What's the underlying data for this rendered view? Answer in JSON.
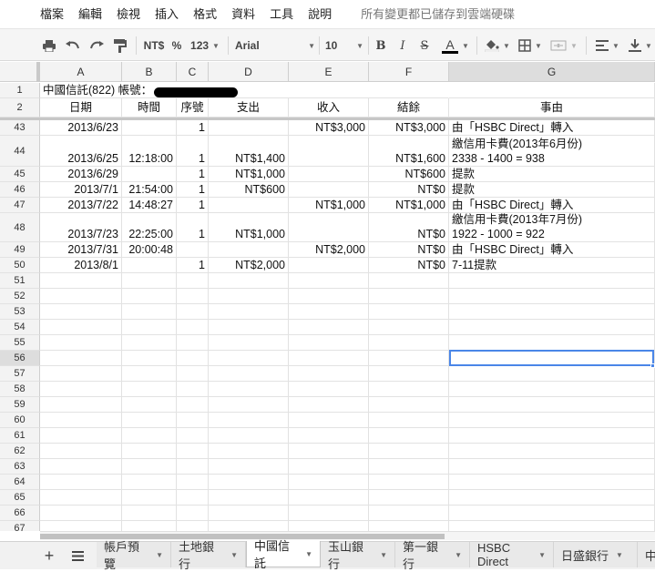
{
  "menu": {
    "items": [
      "檔案",
      "編輯",
      "檢視",
      "插入",
      "格式",
      "資料",
      "工具",
      "說明"
    ],
    "status": "所有變更都已儲存到雲端硬碟"
  },
  "toolbar": {
    "currency": "NT$",
    "percent": "%",
    "number_format": "123",
    "font": "Arial",
    "font_size": "10",
    "bold": "B",
    "italic": "I",
    "strike": "S",
    "text_color_letter": "A"
  },
  "columns": [
    "A",
    "B",
    "C",
    "D",
    "E",
    "F",
    "G"
  ],
  "selected_column": "G",
  "header_rows": {
    "r1_label": "1",
    "r1_title": "中國信託(822) 帳號：",
    "r2_label": "2",
    "r2_cells": [
      "日期",
      "時間",
      "序號",
      "支出",
      "收入",
      "結餘",
      "事由"
    ]
  },
  "rows": [
    {
      "n": "43",
      "cells": [
        "2013/6/23",
        "",
        "1",
        "",
        "NT$3,000",
        "NT$3,000",
        "由「HSBC Direct」轉入"
      ]
    },
    {
      "n": "44",
      "cells": [
        "2013/6/25",
        "12:18:00",
        "1",
        "NT$1,400",
        "",
        "NT$1,600",
        [
          "繳信用卡費(2013年6月份)",
          "2338 - 1400 = 938"
        ]
      ]
    },
    {
      "n": "45",
      "cells": [
        "2013/6/29",
        "",
        "1",
        "NT$1,000",
        "",
        "NT$600",
        "提款"
      ]
    },
    {
      "n": "46",
      "cells": [
        "2013/7/1",
        "21:54:00",
        "1",
        "NT$600",
        "",
        "NT$0",
        "提款"
      ]
    },
    {
      "n": "47",
      "cells": [
        "2013/7/22",
        "14:48:27",
        "1",
        "",
        "NT$1,000",
        "NT$1,000",
        "由「HSBC Direct」轉入"
      ]
    },
    {
      "n": "48",
      "cells": [
        "2013/7/23",
        "22:25:00",
        "1",
        "NT$1,000",
        "",
        "NT$0",
        [
          "繳信用卡費(2013年7月份)",
          "1922 - 1000 = 922"
        ]
      ]
    },
    {
      "n": "49",
      "cells": [
        "2013/7/31",
        "20:00:48",
        "",
        "",
        "NT$2,000",
        "NT$0",
        "由「HSBC Direct」轉入"
      ]
    },
    {
      "n": "50",
      "cells": [
        "2013/8/1",
        "",
        "1",
        "NT$2,000",
        "",
        "NT$0",
        "7-11提款"
      ]
    },
    {
      "n": "51",
      "cells": []
    },
    {
      "n": "52",
      "cells": []
    },
    {
      "n": "53",
      "cells": []
    },
    {
      "n": "54",
      "cells": []
    },
    {
      "n": "55",
      "cells": []
    },
    {
      "n": "56",
      "cells": []
    },
    {
      "n": "57",
      "cells": []
    },
    {
      "n": "58",
      "cells": []
    },
    {
      "n": "59",
      "cells": []
    },
    {
      "n": "60",
      "cells": []
    },
    {
      "n": "61",
      "cells": []
    },
    {
      "n": "62",
      "cells": []
    },
    {
      "n": "63",
      "cells": []
    },
    {
      "n": "64",
      "cells": []
    },
    {
      "n": "65",
      "cells": []
    },
    {
      "n": "66",
      "cells": []
    },
    {
      "n": "67",
      "cells": []
    }
  ],
  "selected_row": "56",
  "sheet_tabs": [
    "帳戶預覽",
    "土地銀行",
    "中國信託",
    "玉山銀行",
    "第一銀行",
    "HSBC Direct",
    "日盛銀行",
    "中"
  ],
  "active_sheet": "中國信託",
  "colors": {
    "selection": "#4a86e8",
    "header_bg": "#f3f3f3",
    "selected_header_bg": "#dddddd"
  }
}
